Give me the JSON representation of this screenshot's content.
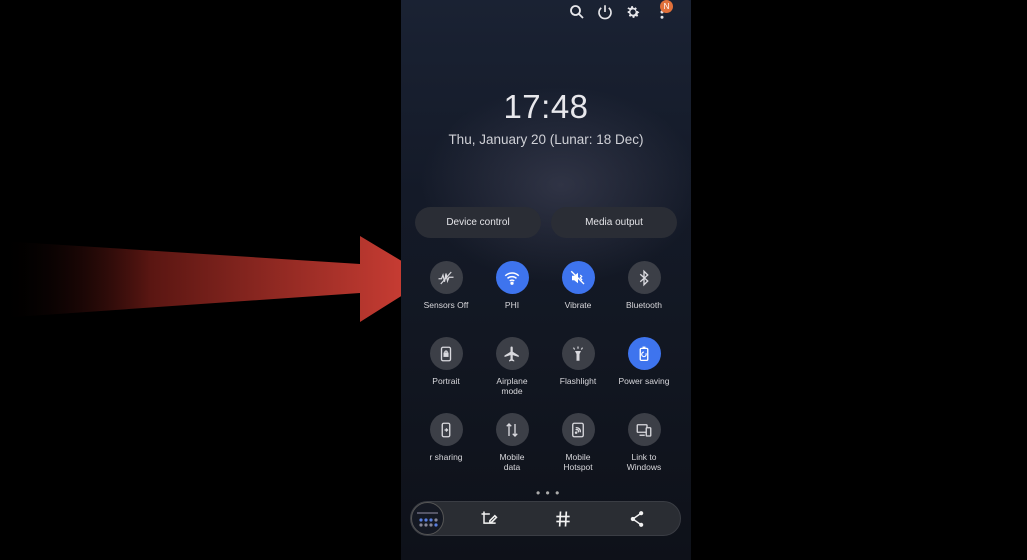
{
  "status": {
    "clock": "17:48",
    "date": "Thu, January 20 (Lunar: 18 Dec)",
    "notification_badge": "N"
  },
  "top_icons": [
    "search-icon",
    "power-icon",
    "gear-icon",
    "more-vert-icon"
  ],
  "pills": {
    "device_control": "Device control",
    "media_output": "Media output"
  },
  "tiles": [
    {
      "label": "Sensors Off",
      "icon": "sensors-off-icon",
      "on": false
    },
    {
      "label": "PHI",
      "icon": "wifi-icon",
      "on": true
    },
    {
      "label": "Vibrate",
      "icon": "vibrate-icon",
      "on": true
    },
    {
      "label": "Bluetooth",
      "icon": "bluetooth-icon",
      "on": false
    },
    {
      "label": "Portrait",
      "icon": "portrait-lock-icon",
      "on": false
    },
    {
      "label": "Airplane\nmode",
      "icon": "airplane-icon",
      "on": false
    },
    {
      "label": "Flashlight",
      "icon": "flashlight-icon",
      "on": false
    },
    {
      "label": "Power saving",
      "icon": "power-saving-icon",
      "on": true
    },
    {
      "label": "r sharing",
      "icon": "share-device-icon",
      "on": false
    },
    {
      "label": "Mobile\ndata",
      "icon": "mobile-data-icon",
      "on": false
    },
    {
      "label": "Mobile\nHotspot",
      "icon": "hotspot-icon",
      "on": false
    },
    {
      "label": "Link to\nWindows",
      "icon": "link-windows-icon",
      "on": false
    }
  ],
  "pager": "• • •",
  "bottom_actions": [
    "crop-edit-icon",
    "hashtag-icon",
    "share-icon"
  ],
  "colors": {
    "accent": "#3e74ee",
    "arrow": "#c23a32",
    "tile_off": "#3c3f47"
  }
}
